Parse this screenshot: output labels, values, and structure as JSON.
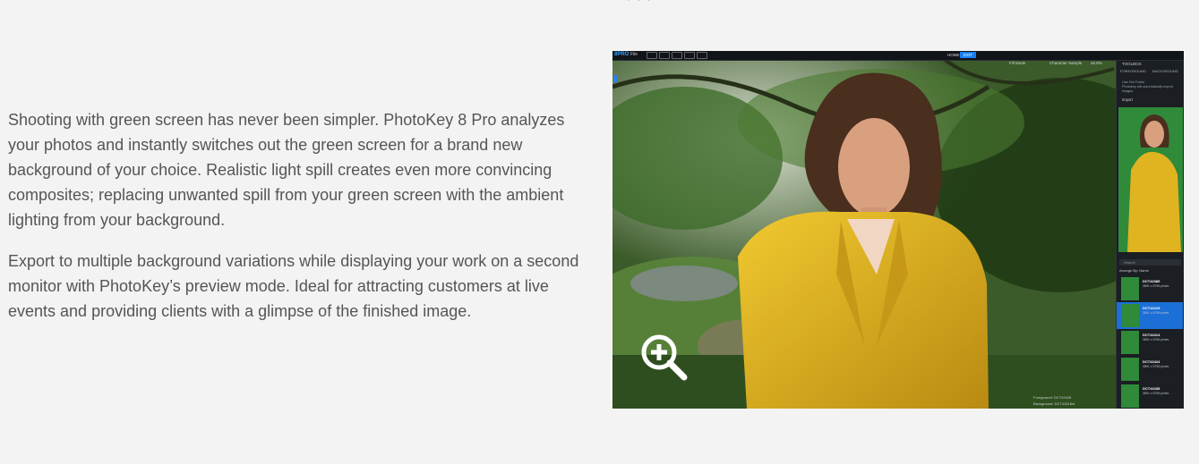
{
  "paragraphs": [
    "Shooting with green screen has never been simpler. PhotoKey 8 Pro analyzes your photos and instantly switches out the green screen for a brand new background of your choice. Realistic light spill creates even more convincing composites; replacing unwanted spill from your green screen with the ambient lighting from your background.",
    "Export to multiple background variations while displaying your work on a second monitor with PhotoKey’s preview mode. Ideal for attracting customers at live events and providing clients with a glimpse of the finished image."
  ],
  "app": {
    "logo": "8PRO",
    "file_menu": "File",
    "modes": [
      "HOME",
      "EXIT"
    ],
    "active_mode": "EXIT",
    "subbar": [
      "Fill Mode",
      "Character Sample",
      "46.8%"
    ],
    "toolbox": {
      "title": "TOOLBOX",
      "tabs": [
        "FOREGROUND",
        "BACKGROUND"
      ],
      "option_label": "Use Hot Folder",
      "option_desc": "Photokey will automatically import images",
      "import_label": "Import"
    },
    "search_placeholder": "Search",
    "arrange_label": "Arrange By: Name",
    "files": [
      {
        "name": "DCT42389",
        "meta": "3891 x 5796 pixels"
      },
      {
        "name": "DCT42415",
        "meta": "3891 x 5796 pixels"
      },
      {
        "name": "DCT42414",
        "meta": "3891 x 5796 pixels"
      },
      {
        "name": "DCT42424",
        "meta": "3891 x 5796 pixels"
      },
      {
        "name": "DCT42438",
        "meta": "3891 x 5796 pixels"
      }
    ],
    "selected_file_index": 1,
    "footer": {
      "foreground_label": "Foreground:",
      "foreground_value": "DCT42415",
      "background_label": "Background:",
      "background_value": "DCT41518of"
    }
  },
  "zoom_icon": "zoom-in-icon",
  "colors": {
    "text": "#555555",
    "page_bg": "#f4f3f3",
    "accent": "#1a7ff0",
    "coat": "#e0b321",
    "green_screen": "#2f8a3a"
  }
}
